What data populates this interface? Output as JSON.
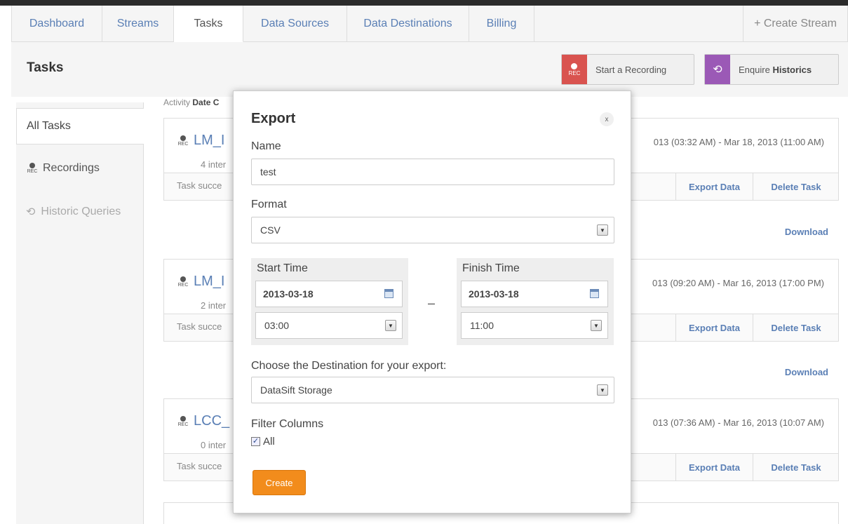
{
  "nav": {
    "tabs": [
      "Dashboard",
      "Streams",
      "Tasks",
      "Data Sources",
      "Data Destinations",
      "Billing"
    ],
    "active_tab": "Tasks",
    "create_stream": "+ Create Stream"
  },
  "header": {
    "title": "Tasks",
    "recording_button": "Start a Recording",
    "recording_icon_text": "REC",
    "historics_button_prefix": "Enquire",
    "historics_button_bold": "Historics",
    "recording_color": "#d9534f",
    "historics_color": "#9b59b6"
  },
  "sidebar": {
    "items": [
      {
        "label": "All Tasks"
      },
      {
        "label": "Recordings"
      },
      {
        "label": "Historic Queries"
      }
    ],
    "rec_icon_text": "REC"
  },
  "activity": {
    "prefix": "Activity",
    "sort": "Date C"
  },
  "tasks": [
    {
      "title": "LM_I",
      "sub": "4 inter",
      "dates": "013 (03:32 AM) - Mar 18, 2013 (11:00 AM)",
      "status": "Task succe",
      "export": "Export Data",
      "delete": "Delete Task",
      "download": "Download"
    },
    {
      "title": "LM_I",
      "sub": "2 inter",
      "dates": "013 (09:20 AM) - Mar 16, 2013 (17:00 PM)",
      "status": "Task succe",
      "export": "Export Data",
      "delete": "Delete Task",
      "download": "Download"
    },
    {
      "title": "LCC_",
      "sub": "0 inter",
      "dates": "013 (07:36 AM) - Mar 16, 2013 (10:07 AM)",
      "status": "Task succe",
      "export": "Export Data",
      "delete": "Delete Task",
      "download": ""
    }
  ],
  "modal": {
    "title": "Export",
    "close": "x",
    "name_label": "Name",
    "name_value": "test",
    "format_label": "Format",
    "format_value": "CSV",
    "start_label": "Start Time",
    "start_date": "2013-03-18",
    "start_time": "03:00",
    "finish_label": "Finish Time",
    "finish_date": "2013-03-18",
    "finish_time": "11:00",
    "separator": "–",
    "destination_label": "Choose the Destination for your export:",
    "destination_value": "DataSift Storage",
    "filter_label": "Filter Columns",
    "filter_all": "All",
    "create_button": "Create",
    "create_color": "#f28c1c"
  }
}
